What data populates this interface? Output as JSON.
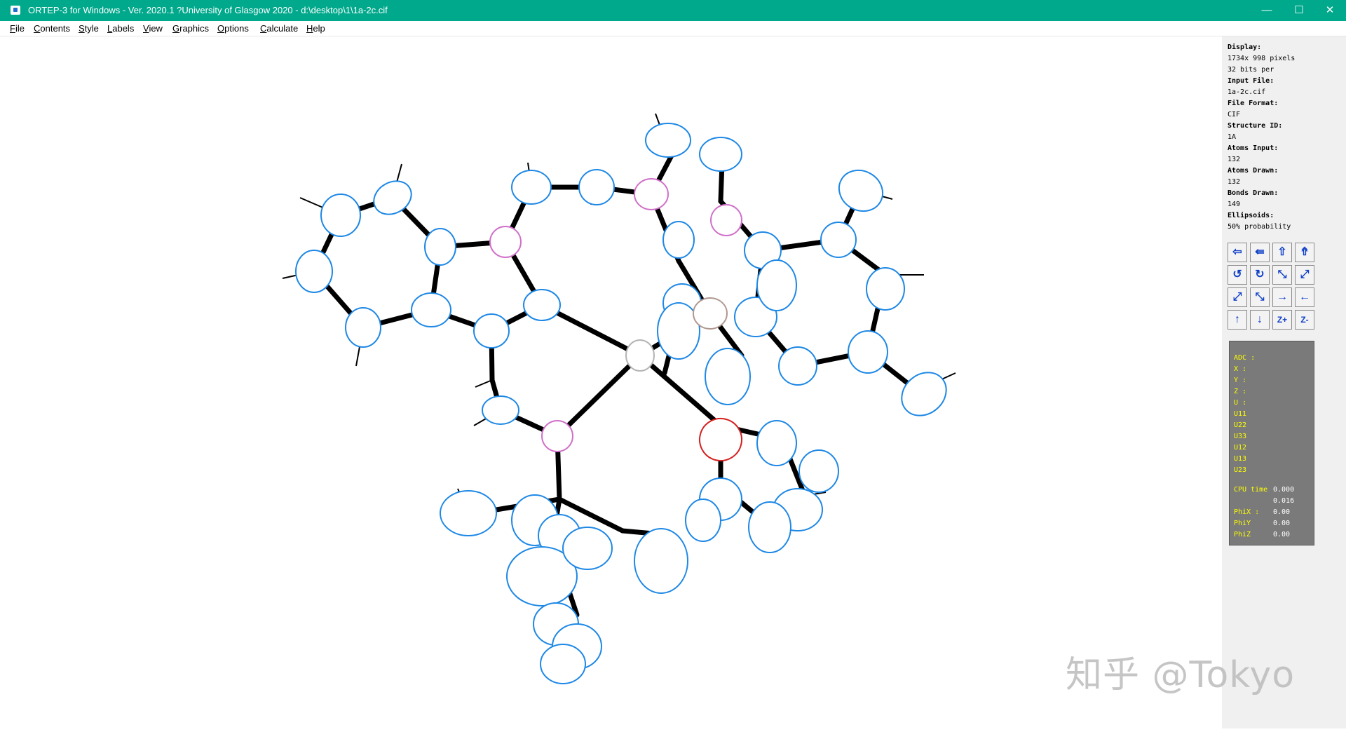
{
  "titlebar": {
    "title": "ORTEP-3 for Windows - Ver. 2020.1   ?University of Glasgow 2020 - d:\\desktop\\1\\1a-2c.cif",
    "minimize": "—",
    "maximize": "☐",
    "close": "✕"
  },
  "menu": [
    "File",
    "Contents",
    "Style",
    "Labels",
    "View",
    "Graphics",
    "Options",
    "Calculate",
    "Help"
  ],
  "info": {
    "display_h": "Display:",
    "display_1": "1734x 998 pixels",
    "display_2": "32 bits per",
    "input_h": "Input File:",
    "input_v": "1a-2c.cif",
    "format_h": "File Format:",
    "format_v": "CIF",
    "struct_h": "Structure ID:",
    "struct_v": "1A",
    "atoms_in_h": "Atoms Input:",
    "atoms_in_v": "132",
    "atoms_dr_h": "Atoms Drawn:",
    "atoms_dr_v": "132",
    "bonds_h": "Bonds Drawn:",
    "bonds_v": "149",
    "ell_h": "Ellipsoids:",
    "ell_v": "50% probability"
  },
  "toolbar": [
    {
      "name": "rotate-left-icon",
      "glyph": "⇦"
    },
    {
      "name": "rotate-left-alt-icon",
      "glyph": "⇚"
    },
    {
      "name": "rotate-up-icon",
      "glyph": "⇧"
    },
    {
      "name": "rotate-up-alt-icon",
      "glyph": "⇮"
    },
    {
      "name": "spin-ccw-icon",
      "glyph": "↺"
    },
    {
      "name": "spin-cw-icon",
      "glyph": "↻"
    },
    {
      "name": "zoom-in-icon",
      "glyph": "⤡"
    },
    {
      "name": "zoom-out-icon",
      "glyph": "⤢"
    },
    {
      "name": "enlarge-icon",
      "glyph": "⤢"
    },
    {
      "name": "shrink-icon",
      "glyph": "⤡"
    },
    {
      "name": "move-right-icon",
      "glyph": "→"
    },
    {
      "name": "move-left-icon",
      "glyph": "←"
    },
    {
      "name": "move-up-icon",
      "glyph": "↑"
    },
    {
      "name": "move-down-icon",
      "glyph": "↓"
    },
    {
      "name": "z-plus-icon",
      "glyph": "Z+"
    },
    {
      "name": "z-minus-icon",
      "glyph": "Z-"
    }
  ],
  "readout": {
    "rows": [
      "ADC :",
      "X :",
      "Y :",
      "Z :",
      "U :",
      "U11",
      "U22",
      "U33",
      "U12",
      "U13",
      "U23"
    ],
    "cpu_label": "CPU time",
    "cpu_val_1": "0.000",
    "cpu_val_2": "0.016",
    "phix_label": "PhiX :",
    "phix_val": "0.00",
    "phiy_label": "PhiY",
    "phiy_val": "0.00",
    "phiz_label": "PhiZ",
    "phiz_val": "0.00"
  },
  "watermark": "知乎 @Tokyo",
  "colors": {
    "titlebar": "#00a98c",
    "carbon": "#1e88e5",
    "nitrogen": "#d070c8",
    "oxygen": "#d42020",
    "metal": "#c8b4b0",
    "bond": "#000000"
  }
}
